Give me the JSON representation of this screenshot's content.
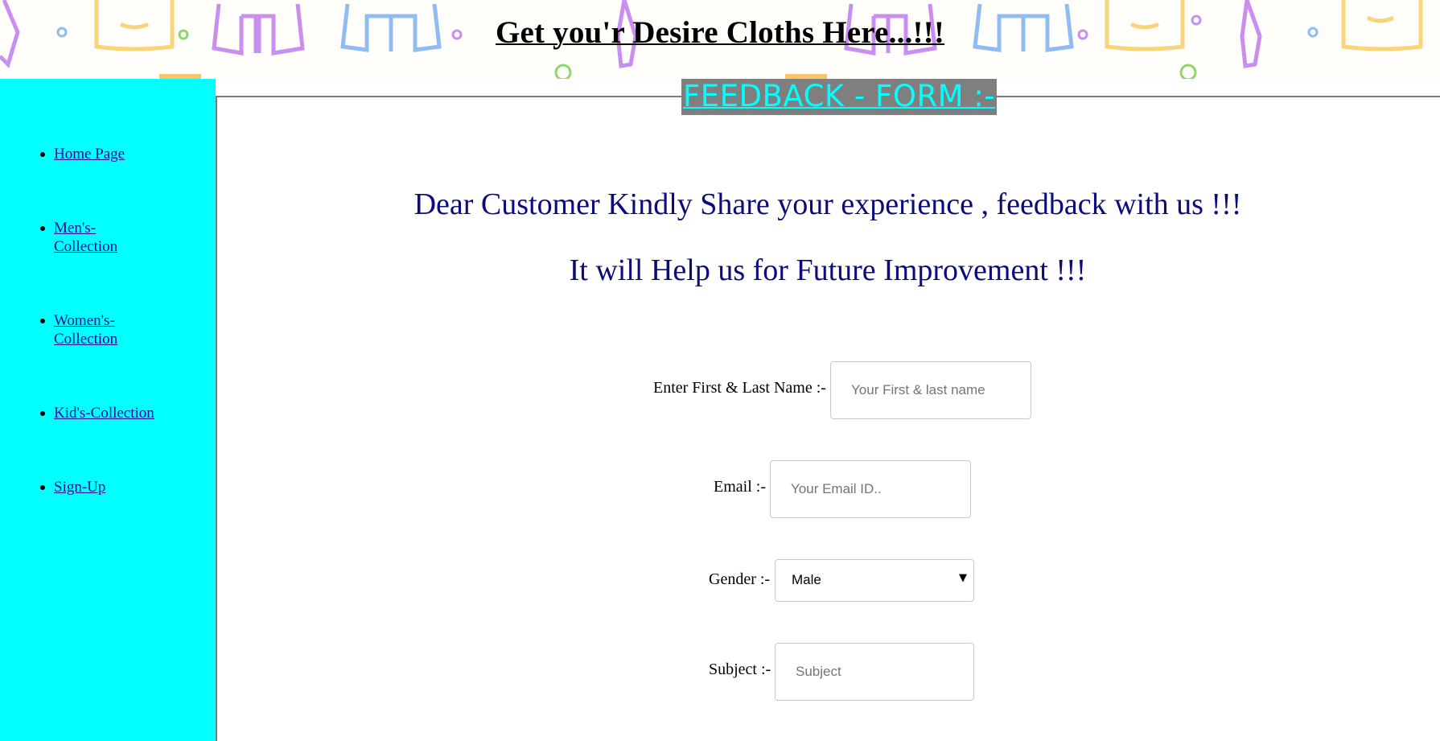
{
  "header": {
    "title": "Get you'r Desire Cloths Here...!!!"
  },
  "sidebar": {
    "items": [
      {
        "label": "Home Page"
      },
      {
        "label": "Men's-Collection"
      },
      {
        "label": "Women's-Collection"
      },
      {
        "label": "Kid's-Collection"
      },
      {
        "label": "Sign-Up"
      }
    ]
  },
  "form": {
    "legend": "FEEDBACK - FORM :-",
    "message_line1": "Dear Customer Kindly Share your experience , feedback with us !!!",
    "message_line2": "It will Help us for Future Improvement !!!",
    "name_label": "Enter First & Last Name :-",
    "name_placeholder": "Your First & last name",
    "email_label": "Email :-",
    "email_placeholder": "Your Email ID..",
    "gender_label": "Gender :-",
    "gender_selected": "Male",
    "subject_label": "Subject :-",
    "subject_placeholder": "Subject"
  },
  "colors": {
    "sidebar_bg": "#00ffff",
    "legend_bg": "#7f7f7f",
    "legend_text": "#00ffff",
    "message_text": "#0b0b7a",
    "link": "#1b0f9a"
  },
  "icons": [
    "shirt-icon",
    "jacket-icon",
    "tie-icon",
    "ring-icon",
    "dropdown-arrow-icon"
  ]
}
